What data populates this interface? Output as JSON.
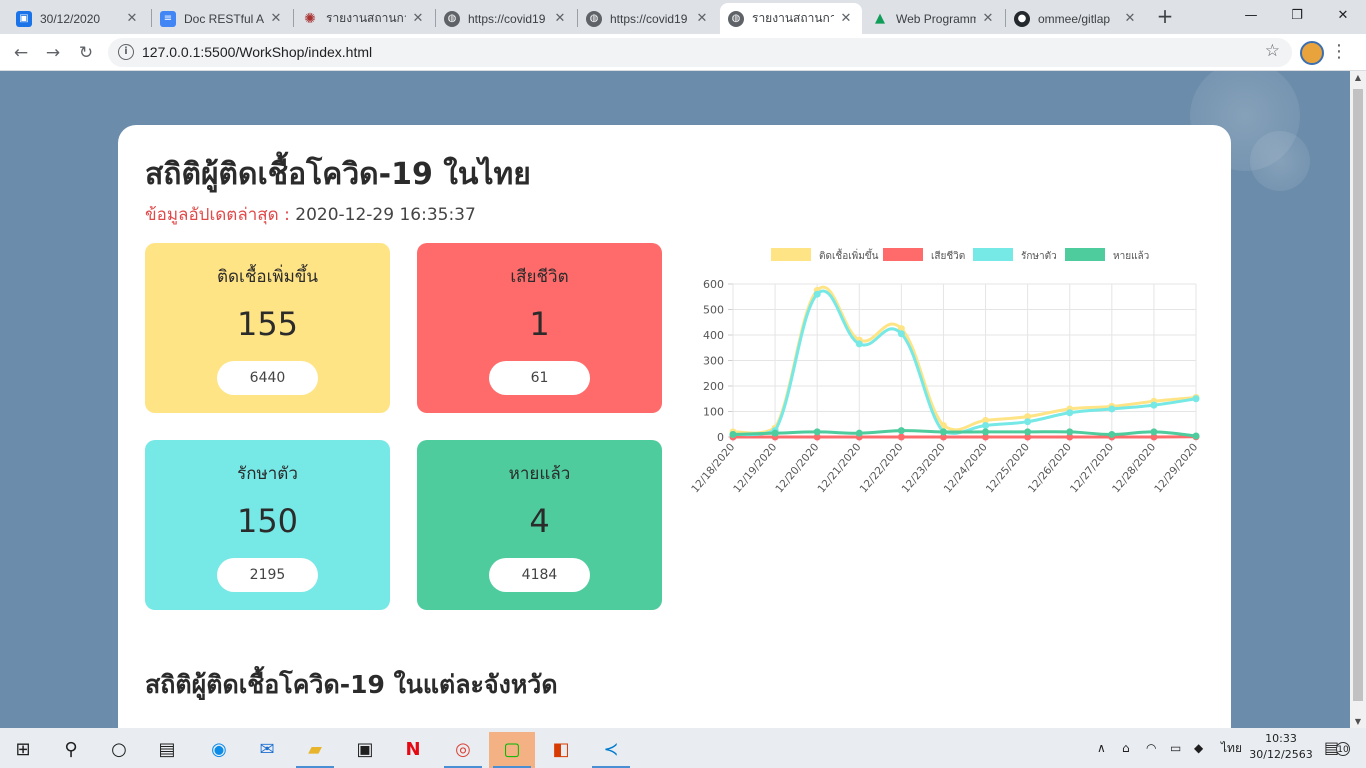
{
  "browser": {
    "tabs": [
      {
        "title": "30/12/2020",
        "icon": "contacts-icon",
        "color": "#1a73e8"
      },
      {
        "title": "Doc RESTful API",
        "icon": "docs-icon",
        "color": "#4285f4"
      },
      {
        "title": "รายงานสถานการณ์",
        "icon": "virus-icon",
        "color": "#a83232"
      },
      {
        "title": "https://covid19",
        "icon": "globe-icon",
        "color": "#5f6368"
      },
      {
        "title": "https://covid19",
        "icon": "globe-icon",
        "color": "#5f6368"
      },
      {
        "title": "รายงานสถานการณ์",
        "icon": "globe-icon",
        "color": "#5f6368"
      },
      {
        "title": "Web Programming",
        "icon": "drive-icon",
        "color": "#0f9d58"
      },
      {
        "title": "ommee/gitlap",
        "icon": "github-icon",
        "color": "#24292e"
      }
    ],
    "new_tab": "+",
    "url": "127.0.0.1:5500/WorkShop/index.html"
  },
  "page": {
    "title": "สถิติผู้ติดเชื้อโควิด-19 ในไทย",
    "updated_label": "ข้อมูลอัปเดตล่าสุด :",
    "updated_value": "2020-12-29 16:35:37",
    "section_title": "สถิติผู้ติดเชื้อโควิด-19 ในแต่ละจังหวัด"
  },
  "stats": [
    {
      "label": "ติดเชื้อเพิ่มขึ้น",
      "value": "155",
      "total": "6440",
      "color": "#ffe486"
    },
    {
      "label": "เสียชีวิต",
      "value": "1",
      "total": "61",
      "color": "#ff6b6b"
    },
    {
      "label": "รักษาตัว",
      "value": "150",
      "total": "2195",
      "color": "#76e8e6"
    },
    {
      "label": "หายแล้ว",
      "value": "4",
      "total": "4184",
      "color": "#4ecc9e"
    }
  ],
  "chart_data": {
    "type": "line",
    "categories": [
      "12/18/2020",
      "12/19/2020",
      "12/20/2020",
      "12/21/2020",
      "12/22/2020",
      "12/23/2020",
      "12/24/2020",
      "12/25/2020",
      "12/26/2020",
      "12/27/2020",
      "12/28/2020",
      "12/29/2020"
    ],
    "ylim": [
      0,
      600
    ],
    "yticks": [
      0,
      100,
      200,
      300,
      400,
      500,
      600
    ],
    "grid": true,
    "legend_position": "top",
    "series": [
      {
        "name": "ติดเชื้อเพิ่มขึ้น",
        "color": "#ffe486",
        "values": [
          20,
          35,
          575,
          380,
          425,
          45,
          65,
          80,
          110,
          120,
          140,
          155
        ]
      },
      {
        "name": "เสียชีวิต",
        "color": "#ff6b6b",
        "values": [
          0,
          0,
          0,
          0,
          0,
          0,
          0,
          0,
          0,
          0,
          0,
          1
        ]
      },
      {
        "name": "รักษาตัว",
        "color": "#76e8e6",
        "values": [
          10,
          25,
          560,
          365,
          405,
          20,
          45,
          60,
          95,
          110,
          125,
          150
        ]
      },
      {
        "name": "หายแล้ว",
        "color": "#4ecc9e",
        "values": [
          10,
          15,
          20,
          15,
          25,
          20,
          20,
          20,
          20,
          10,
          20,
          4
        ]
      }
    ]
  },
  "taskbar": {
    "language": "ไทย",
    "time": "10:33",
    "date": "30/12/2563",
    "notification_count": "10"
  }
}
